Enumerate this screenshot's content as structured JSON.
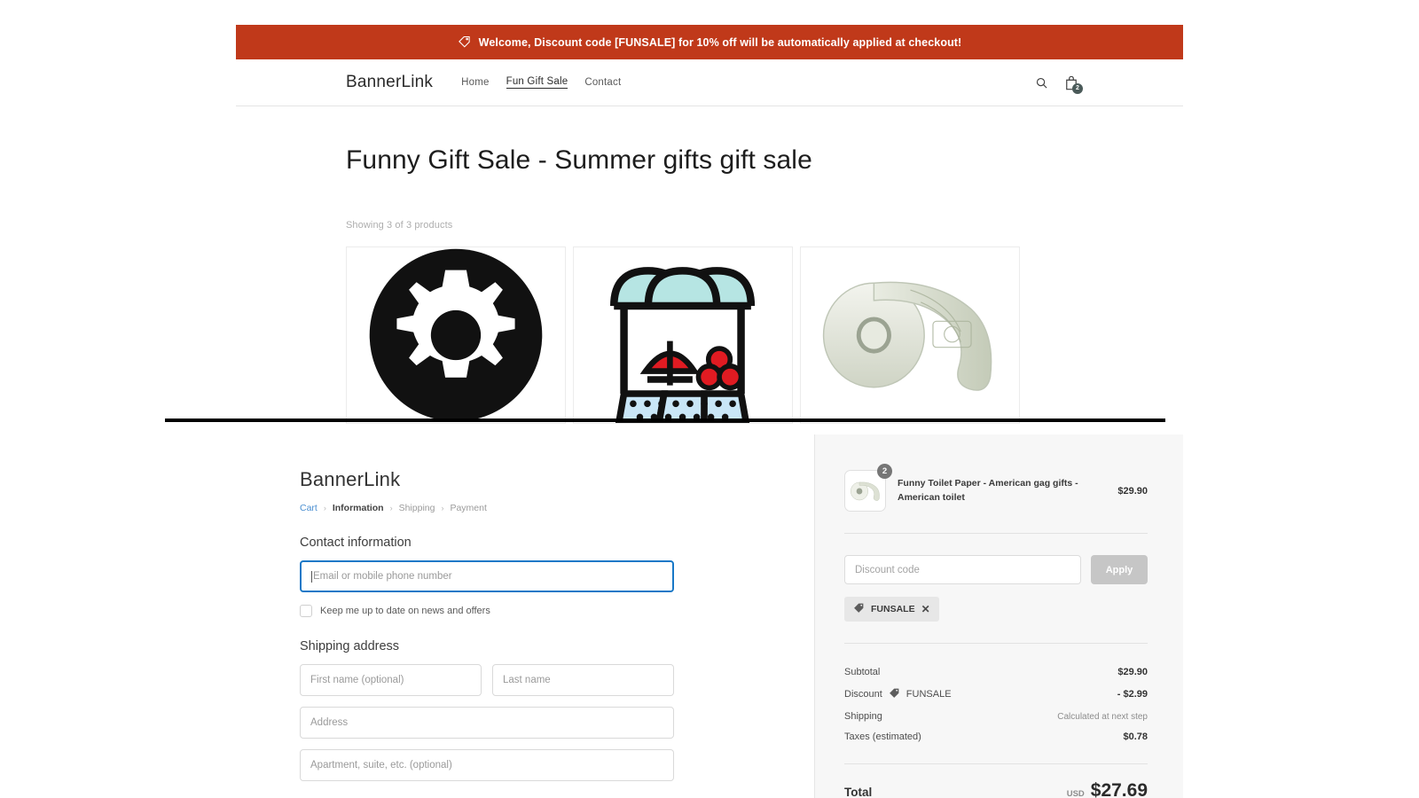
{
  "store": {
    "promo": {
      "icon": "price-tag-icon",
      "text": "Welcome, Discount code [FUNSALE] for 10% off will be automatically applied at checkout!",
      "bg_color": "#c0391a",
      "text_color": "#ffffff"
    },
    "nav": {
      "brand": "BannerLink",
      "links": [
        {
          "label": "Home",
          "active": false
        },
        {
          "label": "Fun Gift Sale",
          "active": true
        },
        {
          "label": "Contact",
          "active": false
        }
      ],
      "search_icon": "search-icon",
      "cart_icon": "shopping-bag-icon",
      "cart_count": "2"
    },
    "title": "Funny Gift Sale - Summer gifts gift sale",
    "showing": "Showing 3 of 3 products",
    "products": [
      {
        "image": "gear-cog-icon",
        "alt": "Black gear settings icon"
      },
      {
        "image": "market-stall-icon",
        "alt": "Market stall with awning"
      },
      {
        "image": "money-toilet-paper-photo",
        "alt": "Roll of dollar-bill toilet paper"
      }
    ]
  },
  "checkout": {
    "brand": "BannerLink",
    "breadcrumb": [
      {
        "label": "Cart",
        "state": "link"
      },
      {
        "label": "Information",
        "state": "current"
      },
      {
        "label": "Shipping",
        "state": "upcoming"
      },
      {
        "label": "Payment",
        "state": "upcoming"
      }
    ],
    "breadcrumb_sep": "›",
    "contact": {
      "heading": "Contact information",
      "email_placeholder": "Email or mobile phone number",
      "email_value": "",
      "newsletter_label": "Keep me up to date on news and offers",
      "newsletter_checked": false
    },
    "shipping": {
      "heading": "Shipping address",
      "first_name_placeholder": "First name (optional)",
      "first_name_value": "",
      "last_name_placeholder": "Last name",
      "last_name_value": "",
      "address_placeholder": "Address",
      "address_value": "",
      "apartment_placeholder": "Apartment, suite, etc. (optional)",
      "apartment_value": ""
    },
    "summary": {
      "item": {
        "name": "Funny Toilet Paper - American gag gifts - American toilet",
        "qty": "2",
        "price": "$29.90",
        "image": "money-toilet-paper-photo"
      },
      "discount_placeholder": "Discount code",
      "discount_value": "",
      "apply_label": "Apply",
      "applied_code": "FUNSALE",
      "remove_icon": "close-icon",
      "rows": [
        {
          "label": "Subtotal",
          "value": "$29.90",
          "muted": false,
          "tag": ""
        },
        {
          "label": "Discount",
          "value": "- $2.99",
          "muted": false,
          "tag": "FUNSALE"
        },
        {
          "label": "Shipping",
          "value": "Calculated at next step",
          "muted": true,
          "tag": ""
        },
        {
          "label": "Taxes (estimated)",
          "value": "$0.78",
          "muted": false,
          "tag": ""
        }
      ],
      "total_label": "Total",
      "total_currency": "USD",
      "total_amount": "$27.69"
    }
  }
}
